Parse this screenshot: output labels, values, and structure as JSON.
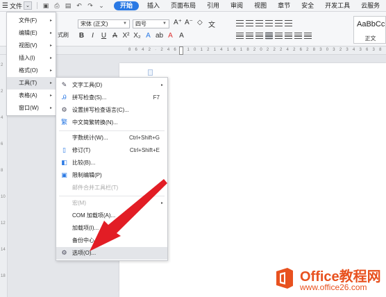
{
  "titlebar": {
    "menu_label": "文件",
    "tabs": [
      "开始",
      "插入",
      "页面布局",
      "引用",
      "审阅",
      "视图",
      "章节",
      "安全",
      "开发工具",
      "云服务"
    ],
    "active_tab": "开始"
  },
  "ribbon": {
    "font_name": "宋体 (正文)",
    "font_size": "四号",
    "format_painter": "式刷",
    "style_sample": "AaBbCc",
    "style_name": "正文",
    "accent_color": "#2a79e4"
  },
  "menu1": {
    "items": [
      {
        "label": "文件(F)",
        "arrow": "▸"
      },
      {
        "label": "编辑(E)",
        "arrow": "▸"
      },
      {
        "label": "视图(V)",
        "arrow": "▸"
      },
      {
        "label": "插入(I)",
        "arrow": "▸"
      },
      {
        "label": "格式(O)",
        "arrow": "▸"
      },
      {
        "label": "工具(T)",
        "arrow": "▸"
      },
      {
        "label": "表格(A)",
        "arrow": "▸"
      },
      {
        "label": "窗口(W)",
        "arrow": "▸"
      }
    ]
  },
  "menu2": {
    "items": [
      {
        "label": "文字工具(D)",
        "shortcut": "",
        "icon": "wrench-icon",
        "arrow": "▸"
      },
      {
        "label": "拼写检查(S)...",
        "shortcut": "F7",
        "icon": "spellcheck-icon"
      },
      {
        "label": "设置拼写检查语言(C)...",
        "shortcut": "",
        "icon": "language-icon"
      },
      {
        "label": "中文简繁转换(N)...",
        "shortcut": "",
        "icon": "convert-icon"
      },
      {
        "label": "字数统计(W)...",
        "shortcut": "Ctrl+Shift+G",
        "icon": ""
      },
      {
        "label": "修订(T)",
        "shortcut": "Ctrl+Shift+E",
        "icon": "track-changes-icon"
      },
      {
        "label": "比较(B)...",
        "shortcut": "",
        "icon": "compare-icon"
      },
      {
        "label": "限制编辑(P)",
        "shortcut": "",
        "icon": "restrict-icon"
      },
      {
        "label": "邮件合并工具栏(T)",
        "shortcut": "",
        "icon": "",
        "disabled": true
      },
      {
        "label": "宏(M)",
        "shortcut": "",
        "icon": "",
        "disabled": true,
        "arrow": "▸"
      },
      {
        "label": "COM 加载项(A)...",
        "shortcut": "",
        "icon": ""
      },
      {
        "label": "加载项(I)...",
        "shortcut": "",
        "icon": ""
      },
      {
        "label": "备份中心",
        "shortcut": "",
        "icon": ""
      },
      {
        "label": "选项(O)...",
        "shortcut": "",
        "icon": "gear-icon"
      }
    ]
  },
  "watermark": {
    "title": "Office教程网",
    "url": "www.office26.com"
  }
}
